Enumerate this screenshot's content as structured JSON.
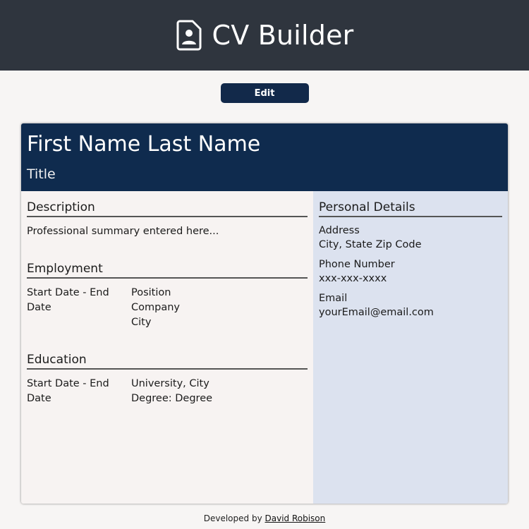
{
  "header": {
    "title": "CV Builder",
    "icon": "file-person-icon"
  },
  "toolbar": {
    "edit_label": "Edit"
  },
  "cv": {
    "name": "First Name Last Name",
    "title": "Title",
    "description": {
      "heading": "Description",
      "text": "Professional summary entered here..."
    },
    "employment": {
      "heading": "Employment",
      "dates": "Start Date - End Date",
      "position": "Position",
      "company": "Company",
      "city": "City"
    },
    "education": {
      "heading": "Education",
      "dates": "Start Date - End Date",
      "university": "University, City",
      "degree": "Degree: Degree"
    },
    "personal": {
      "heading": "Personal Details",
      "address_label": "Address",
      "address_value": "City, State Zip Code",
      "phone_label": "Phone Number",
      "phone_value": "xxx-xxx-xxxx",
      "email_label": "Email",
      "email_value": "yourEmail@email.com"
    }
  },
  "footer": {
    "prefix": "Developed by",
    "author_link": "David Robison"
  },
  "colors": {
    "header_bg": "#2f353e",
    "accent_navy": "#0f2b4e",
    "sidebar_bg": "#dce2ef",
    "page_bg": "#f7f5f4"
  }
}
